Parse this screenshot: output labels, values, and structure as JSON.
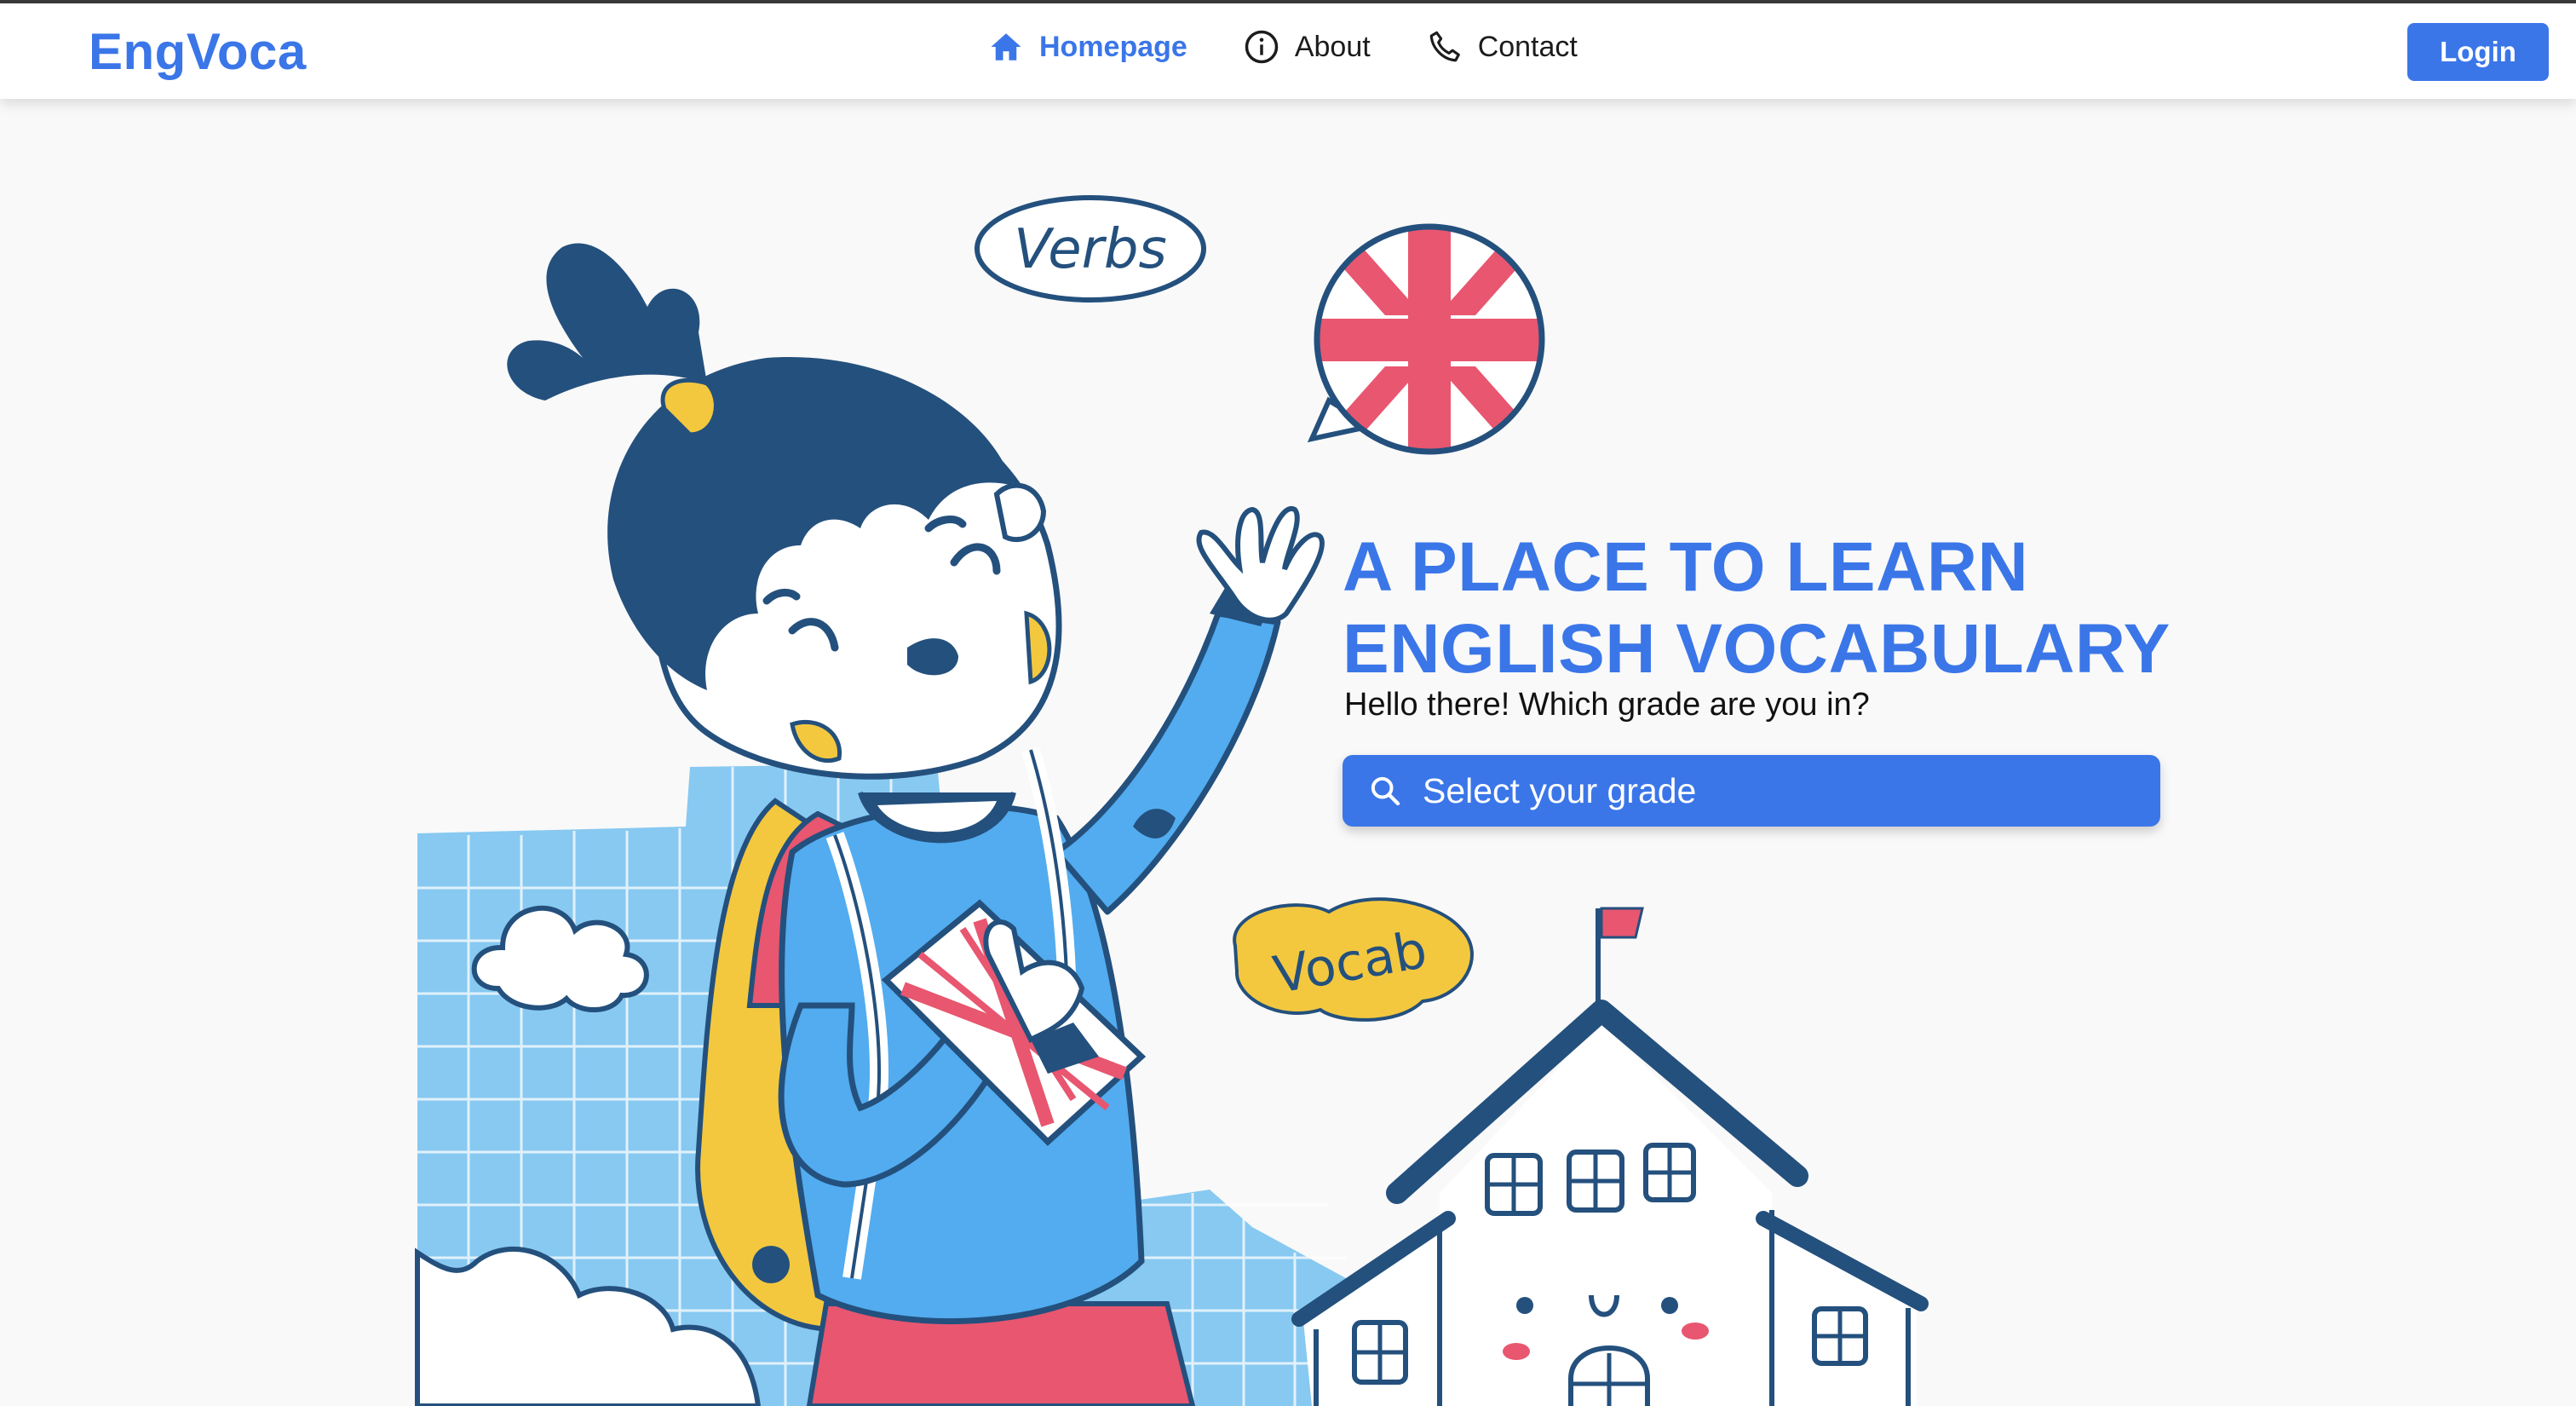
{
  "brand": {
    "name": "EngVoca",
    "color": "#3b76e8"
  },
  "nav": {
    "items": [
      {
        "label": "Homepage",
        "icon": "home-icon",
        "active": true
      },
      {
        "label": "About",
        "icon": "info-icon",
        "active": false
      },
      {
        "label": "Contact",
        "icon": "phone-icon",
        "active": false
      }
    ],
    "login_label": "Login"
  },
  "hero": {
    "title_line1": "A PLACE TO LEARN",
    "title_line2": "ENGLISH VOCABULARY",
    "subtitle": "Hello there! Which grade are you in?",
    "grade_button_label": "Select your grade"
  },
  "illustration": {
    "bubble_verbs": "Verbs",
    "bubble_vocab": "Vocab"
  },
  "colors": {
    "accent": "#3b76e8",
    "navy": "#24507d",
    "sky": "#87c9f1",
    "shirt": "#52acef",
    "flag_red": "#e85670",
    "yellow": "#f3c83f"
  }
}
